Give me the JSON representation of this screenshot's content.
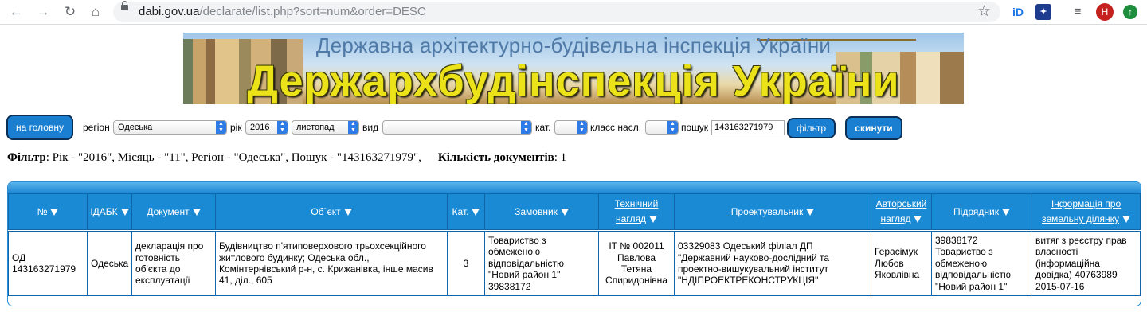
{
  "browser": {
    "url_host": "dabi.gov.ua",
    "url_path": "/declarate/list.php?sort=num&order=DESC",
    "avatar_letter": "H"
  },
  "banner": {
    "subtitle": "Державна архітектурно-будівельна інспекція України",
    "title": "Держархбудінспекція України"
  },
  "filters": {
    "home_button": "на головну",
    "region_label": "регіон",
    "region_value": "Одеська",
    "year_label": "рік",
    "year_value": "2016",
    "month_value": "листопад",
    "type_label": "вид",
    "type_value": "",
    "cat_label": "кат.",
    "class_label": "класс насл.",
    "search_label": "пошук",
    "search_value": "143163271979",
    "filter_button": "фільтр",
    "reset_button": "скинути"
  },
  "filter_info": {
    "label": "Фільтр",
    "text": ": Рік - \"2016\", Місяць - \"11\", Регіон - \"Одеська\", Пошук - \"143163271979\",",
    "count_label": "Кількість документів",
    "count_value": ": 1"
  },
  "table": {
    "headers": [
      "№",
      "ІДАБК",
      "Документ",
      "Об`єкт",
      "Кат.",
      "Замовник",
      "Технічний нагляд",
      "Проектувальник",
      "Авторський нагляд",
      "Підрядник",
      "Інформація про земельну ділянку"
    ],
    "rows": [
      [
        "ОД 143163271979",
        "Одеська",
        "декларація про готовність об'єкта до експлуатації",
        "Будівництво п'ятиповерхового трьохсекційного житлового будинку; Одеська обл., Комінтернівський р-н, с. Крижанівка, інше масив 41, діл., 605",
        "3",
        "Товариство з обмеженою відповідальністю \"Новий район 1\" 39838172",
        "ІТ № 002011 Павлова Тетяна Спиридонівна",
        "03329083 Одеський філіал ДП \"Державний науково-дослідний та проектно-вишукувальний інститут \"НДІПРОЕКТРЕКОНСТРУКЦІЯ\"",
        "Герасімук Любов Яковлівна",
        "39838172 Товариство з обмеженою відповідальністю \"Новий район 1\"",
        "витяг з реєстру прав власності (інформаційна довідка) 40763989 2015-07-16"
      ]
    ]
  }
}
